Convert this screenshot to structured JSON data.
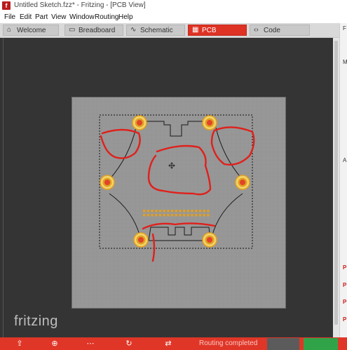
{
  "window": {
    "title": "Untitled Sketch.fzz* - Fritzing - [PCB View]",
    "app_icon": "f"
  },
  "menu": [
    "File",
    "Edit",
    "Part",
    "View",
    "Window",
    "Routing",
    "Help"
  ],
  "tabs": [
    {
      "label": "Welcome",
      "icon": "welcome-icon",
      "glyph": "⌂",
      "active": false
    },
    {
      "label": "Breadboard",
      "icon": "breadboard-icon",
      "glyph": "▭",
      "active": false
    },
    {
      "label": "Schematic",
      "icon": "schematic-icon",
      "glyph": "∿",
      "active": false
    },
    {
      "label": "PCB",
      "icon": "pcb-icon",
      "glyph": "▦",
      "active": true
    },
    {
      "label": "Code",
      "icon": "code-icon",
      "glyph": "‹›",
      "active": false
    }
  ],
  "canvas": {
    "logo_text": "fritzing",
    "background_color": "#343434",
    "board_color": "#979797",
    "pad_color": "#f0d36b",
    "pad_ring_color": "#e2a020",
    "pad_center_color": "#e0442a",
    "annotation_color": "#e0201b"
  },
  "right_panel": {
    "letters": [
      "F",
      "M",
      "A",
      "P",
      "P",
      "P",
      "P"
    ]
  },
  "status_bar": {
    "status_text": "Routing completed",
    "accent": "#e03627"
  }
}
